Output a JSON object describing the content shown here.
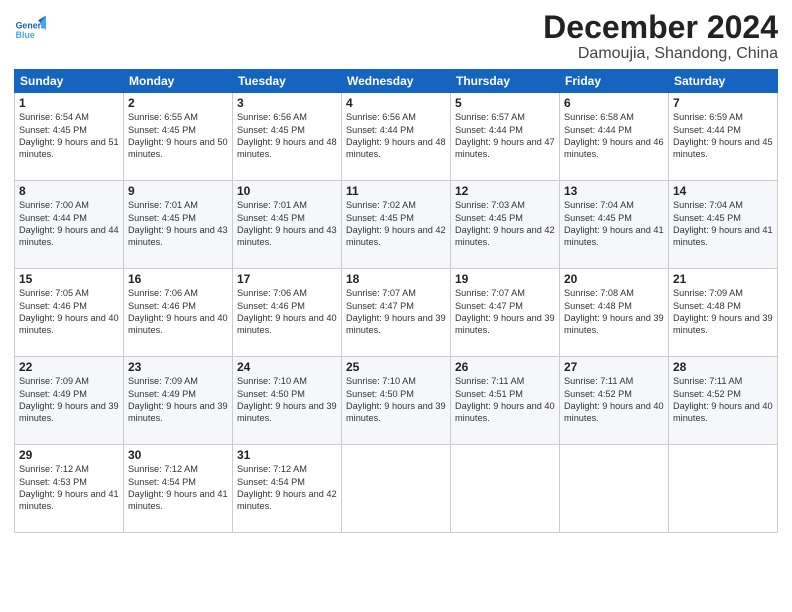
{
  "app": {
    "logo_general": "General",
    "logo_blue": "Blue",
    "title": "December 2024",
    "subtitle": "Damoujia, Shandong, China"
  },
  "calendar": {
    "headers": [
      "Sunday",
      "Monday",
      "Tuesday",
      "Wednesday",
      "Thursday",
      "Friday",
      "Saturday"
    ],
    "weeks": [
      [
        null,
        {
          "day": 2,
          "sunrise": "6:55 AM",
          "sunset": "4:45 PM",
          "daylight": "9 hours and 50 minutes."
        },
        {
          "day": 3,
          "sunrise": "6:56 AM",
          "sunset": "4:45 PM",
          "daylight": "9 hours and 48 minutes."
        },
        {
          "day": 4,
          "sunrise": "6:56 AM",
          "sunset": "4:44 PM",
          "daylight": "9 hours and 48 minutes."
        },
        {
          "day": 5,
          "sunrise": "6:57 AM",
          "sunset": "4:44 PM",
          "daylight": "9 hours and 47 minutes."
        },
        {
          "day": 6,
          "sunrise": "6:58 AM",
          "sunset": "4:44 PM",
          "daylight": "9 hours and 46 minutes."
        },
        {
          "day": 7,
          "sunrise": "6:59 AM",
          "sunset": "4:44 PM",
          "daylight": "9 hours and 45 minutes."
        }
      ],
      [
        {
          "day": 1,
          "sunrise": "6:54 AM",
          "sunset": "4:45 PM",
          "daylight": "9 hours and 51 minutes."
        },
        null,
        null,
        null,
        null,
        null,
        null
      ],
      [
        {
          "day": 8,
          "sunrise": "7:00 AM",
          "sunset": "4:44 PM",
          "daylight": "9 hours and 44 minutes."
        },
        {
          "day": 9,
          "sunrise": "7:01 AM",
          "sunset": "4:45 PM",
          "daylight": "9 hours and 43 minutes."
        },
        {
          "day": 10,
          "sunrise": "7:01 AM",
          "sunset": "4:45 PM",
          "daylight": "9 hours and 43 minutes."
        },
        {
          "day": 11,
          "sunrise": "7:02 AM",
          "sunset": "4:45 PM",
          "daylight": "9 hours and 42 minutes."
        },
        {
          "day": 12,
          "sunrise": "7:03 AM",
          "sunset": "4:45 PM",
          "daylight": "9 hours and 42 minutes."
        },
        {
          "day": 13,
          "sunrise": "7:04 AM",
          "sunset": "4:45 PM",
          "daylight": "9 hours and 41 minutes."
        },
        {
          "day": 14,
          "sunrise": "7:04 AM",
          "sunset": "4:45 PM",
          "daylight": "9 hours and 41 minutes."
        }
      ],
      [
        {
          "day": 15,
          "sunrise": "7:05 AM",
          "sunset": "4:46 PM",
          "daylight": "9 hours and 40 minutes."
        },
        {
          "day": 16,
          "sunrise": "7:06 AM",
          "sunset": "4:46 PM",
          "daylight": "9 hours and 40 minutes."
        },
        {
          "day": 17,
          "sunrise": "7:06 AM",
          "sunset": "4:46 PM",
          "daylight": "9 hours and 40 minutes."
        },
        {
          "day": 18,
          "sunrise": "7:07 AM",
          "sunset": "4:47 PM",
          "daylight": "9 hours and 39 minutes."
        },
        {
          "day": 19,
          "sunrise": "7:07 AM",
          "sunset": "4:47 PM",
          "daylight": "9 hours and 39 minutes."
        },
        {
          "day": 20,
          "sunrise": "7:08 AM",
          "sunset": "4:48 PM",
          "daylight": "9 hours and 39 minutes."
        },
        {
          "day": 21,
          "sunrise": "7:09 AM",
          "sunset": "4:48 PM",
          "daylight": "9 hours and 39 minutes."
        }
      ],
      [
        {
          "day": 22,
          "sunrise": "7:09 AM",
          "sunset": "4:49 PM",
          "daylight": "9 hours and 39 minutes."
        },
        {
          "day": 23,
          "sunrise": "7:09 AM",
          "sunset": "4:49 PM",
          "daylight": "9 hours and 39 minutes."
        },
        {
          "day": 24,
          "sunrise": "7:10 AM",
          "sunset": "4:50 PM",
          "daylight": "9 hours and 39 minutes."
        },
        {
          "day": 25,
          "sunrise": "7:10 AM",
          "sunset": "4:50 PM",
          "daylight": "9 hours and 39 minutes."
        },
        {
          "day": 26,
          "sunrise": "7:11 AM",
          "sunset": "4:51 PM",
          "daylight": "9 hours and 40 minutes."
        },
        {
          "day": 27,
          "sunrise": "7:11 AM",
          "sunset": "4:52 PM",
          "daylight": "9 hours and 40 minutes."
        },
        {
          "day": 28,
          "sunrise": "7:11 AM",
          "sunset": "4:52 PM",
          "daylight": "9 hours and 40 minutes."
        }
      ],
      [
        {
          "day": 29,
          "sunrise": "7:12 AM",
          "sunset": "4:53 PM",
          "daylight": "9 hours and 41 minutes."
        },
        {
          "day": 30,
          "sunrise": "7:12 AM",
          "sunset": "4:54 PM",
          "daylight": "9 hours and 41 minutes."
        },
        {
          "day": 31,
          "sunrise": "7:12 AM",
          "sunset": "4:54 PM",
          "daylight": "9 hours and 42 minutes."
        },
        null,
        null,
        null,
        null
      ]
    ]
  }
}
